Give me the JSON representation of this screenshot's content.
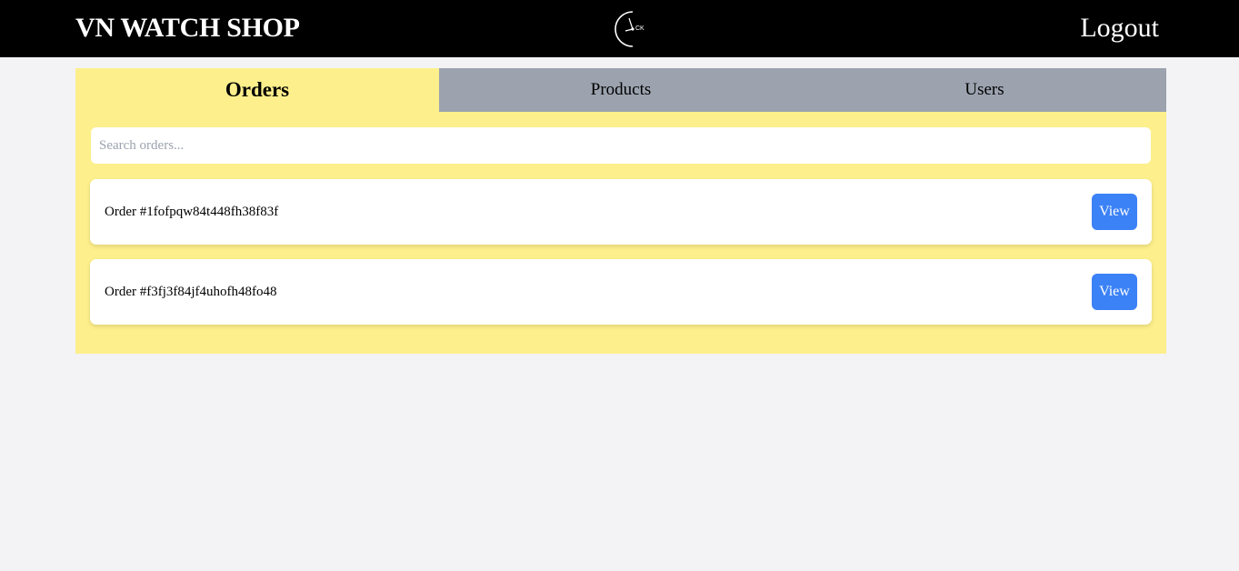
{
  "header": {
    "brand": "VN WATCH SHOP",
    "logo_icon": "clock-logo-icon",
    "logo_text": "CK",
    "logout_label": "Logout"
  },
  "tabs": [
    {
      "label": "Orders",
      "active": true
    },
    {
      "label": "Products",
      "active": false
    },
    {
      "label": "Users",
      "active": false
    }
  ],
  "search": {
    "placeholder": "Search orders...",
    "value": ""
  },
  "orders": [
    {
      "label": "Order #1fofpqw84t448fh38f83f",
      "button": "View"
    },
    {
      "label": "Order #f3fj3f84jf4uhofh48fo48",
      "button": "View"
    }
  ],
  "colors": {
    "header_bg": "#000000",
    "panel_bg": "#fdef8b",
    "inactive_tab_bg": "#9ca3af",
    "button_bg": "#3b82f6",
    "page_bg": "#f3f3f6"
  }
}
